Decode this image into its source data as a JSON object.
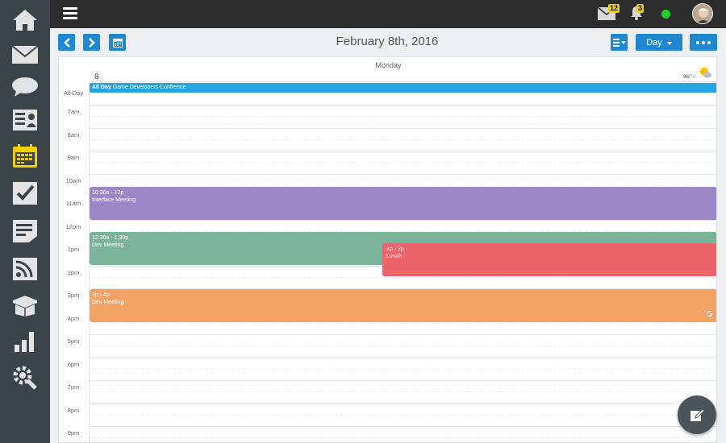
{
  "sidebar": {
    "items": [
      {
        "icon": "home-icon",
        "label": "Home"
      },
      {
        "icon": "mail-icon",
        "label": "Mail"
      },
      {
        "icon": "chat-icon",
        "label": "Chat"
      },
      {
        "icon": "contacts-icon",
        "label": "Contacts"
      },
      {
        "icon": "calendar-icon",
        "label": "Calendar",
        "active": true
      },
      {
        "icon": "tasks-icon",
        "label": "Tasks"
      },
      {
        "icon": "notes-icon",
        "label": "Notes"
      },
      {
        "icon": "rss-icon",
        "label": "RSS"
      },
      {
        "icon": "package-icon",
        "label": "Packages"
      },
      {
        "icon": "stats-icon",
        "label": "Stats"
      },
      {
        "icon": "settings-icon",
        "label": "Settings"
      }
    ],
    "active_color": "#f5d000"
  },
  "topbar": {
    "mail_badge": "12",
    "notification_badge": "3",
    "status_color": "#22d122"
  },
  "toolbar": {
    "date_title": "February 8th, 2016",
    "view_label": "Day"
  },
  "calendar": {
    "day_name": "Monday",
    "day_number": "8",
    "weather": {
      "high": "98",
      "low": "74",
      "icon": "sun-cloud-icon"
    },
    "allday_label": "All-Day",
    "allday_event": {
      "tag": "All Day",
      "title": "Game Developers Confrence",
      "color": "#26a3e3"
    },
    "time_labels": [
      "7am",
      "8am",
      "9am",
      "10am",
      "11am",
      "12pm",
      "1pm",
      "2pm",
      "3pm",
      "4pm",
      "5pm",
      "6pm",
      "7pm",
      "8pm",
      "9pm"
    ],
    "events": [
      {
        "time": "10:30a - 12p",
        "title": "Interface Meeting",
        "color": "#9b87c5"
      },
      {
        "time": "12:30a - 1:30p",
        "title": "Dev Meeting",
        "color": "#79b39a"
      },
      {
        "time": "1p - 2p",
        "title": "Lunch",
        "color": "#ee646b"
      },
      {
        "time": "3p - 4p",
        "title": "Dev Meeting",
        "color": "#f3a265",
        "recurring": true
      }
    ]
  }
}
